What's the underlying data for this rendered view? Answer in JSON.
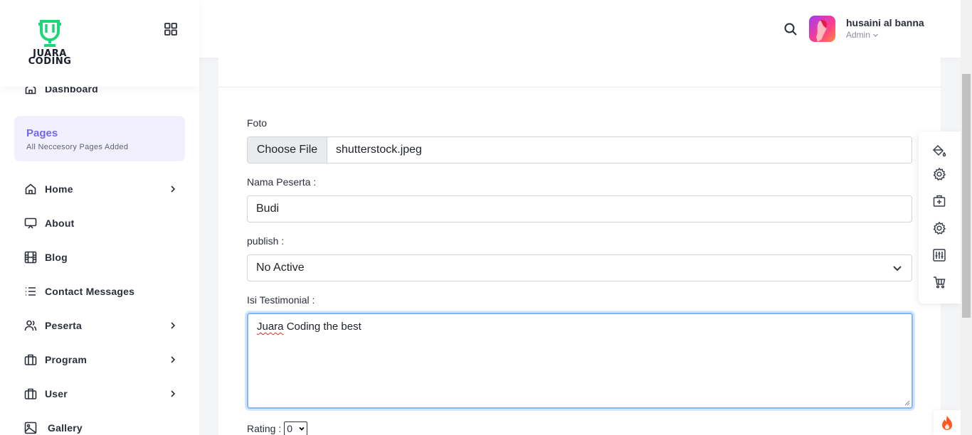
{
  "brand": {
    "line1": "JUARA",
    "line2": "CODING",
    "accent": "#1ed67a"
  },
  "sidebar": {
    "dashboard": "Dashboard",
    "pages_title": "Pages",
    "pages_subtitle": "All Neccesory Pages Added",
    "items": [
      {
        "label": "Home",
        "icon": "home-icon",
        "has_submenu": true
      },
      {
        "label": "About",
        "icon": "presentation-icon",
        "has_submenu": false
      },
      {
        "label": "Blog",
        "icon": "film-icon",
        "has_submenu": false
      },
      {
        "label": "Contact Messages",
        "icon": "list-icon",
        "has_submenu": false
      },
      {
        "label": "Peserta",
        "icon": "users-icon",
        "has_submenu": true
      },
      {
        "label": "Program",
        "icon": "briefcase-icon",
        "has_submenu": true
      },
      {
        "label": "User",
        "icon": "briefcase-icon",
        "has_submenu": true
      },
      {
        "label": "Gallery",
        "icon": "image-icon",
        "has_submenu": false
      }
    ]
  },
  "header": {
    "user_name": "husaini al banna",
    "user_role": "Admin"
  },
  "form": {
    "foto_label": "Foto",
    "file_button": "Choose File",
    "file_name": "shutterstock.jpeg",
    "nama_label": "Nama Peserta :",
    "nama_value": "Budi",
    "publish_label": "publish :",
    "publish_value": "No Active",
    "isi_label": "Isi Testimonial :",
    "isi_word1": "Juara",
    "isi_rest": " Coding the best",
    "rating_label": "Rating :",
    "rating_value": "0"
  },
  "colors": {
    "primary": "#7367f0",
    "focus": "#86b7fe",
    "flame": "#ff5722"
  }
}
